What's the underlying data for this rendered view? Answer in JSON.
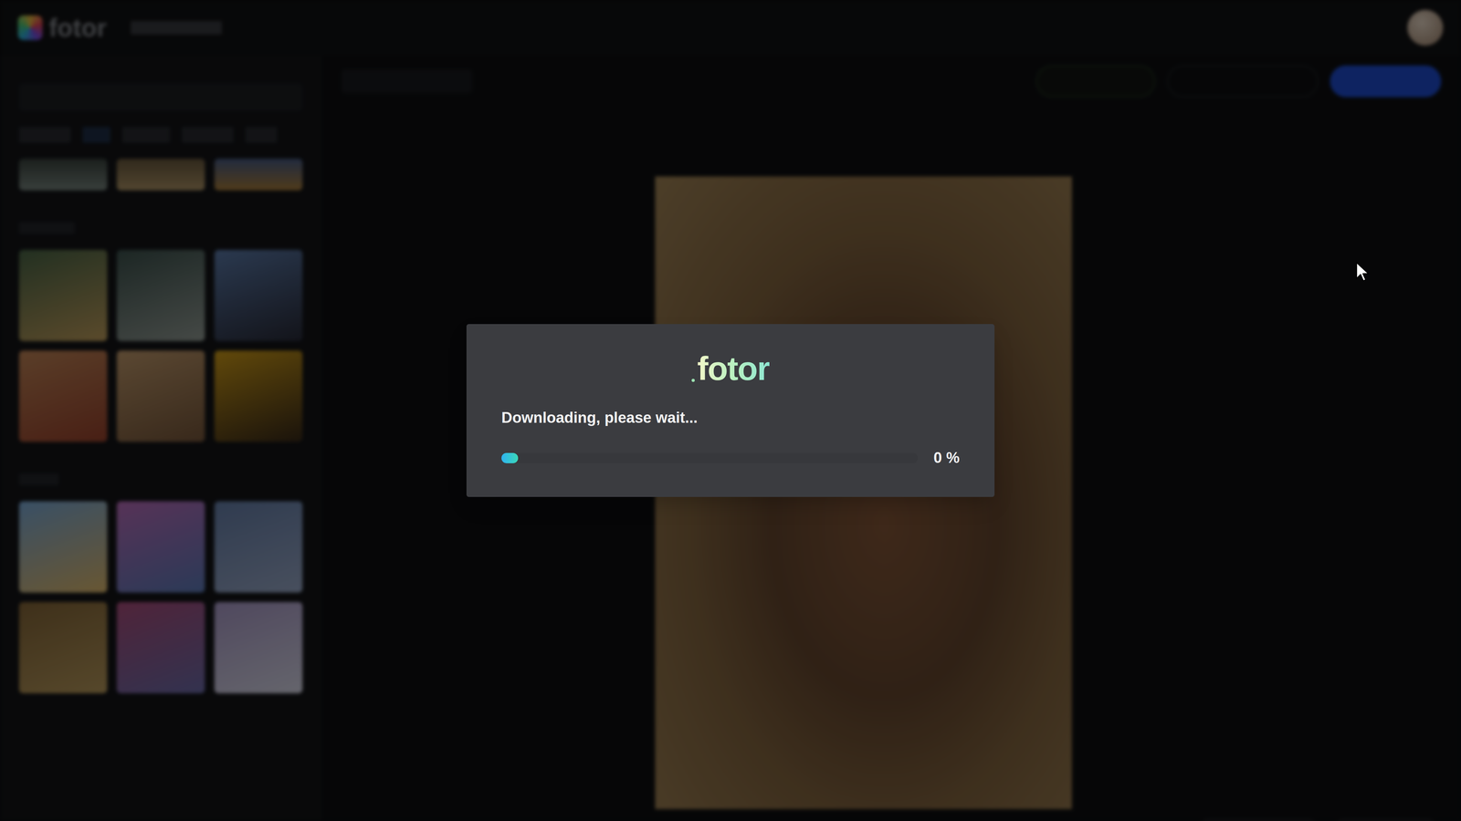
{
  "header": {
    "logo": "fotor"
  },
  "dialog": {
    "logo": "fotor",
    "message": "Downloading, please wait...",
    "progress": {
      "level": 0.04,
      "reading": "0 %"
    }
  }
}
